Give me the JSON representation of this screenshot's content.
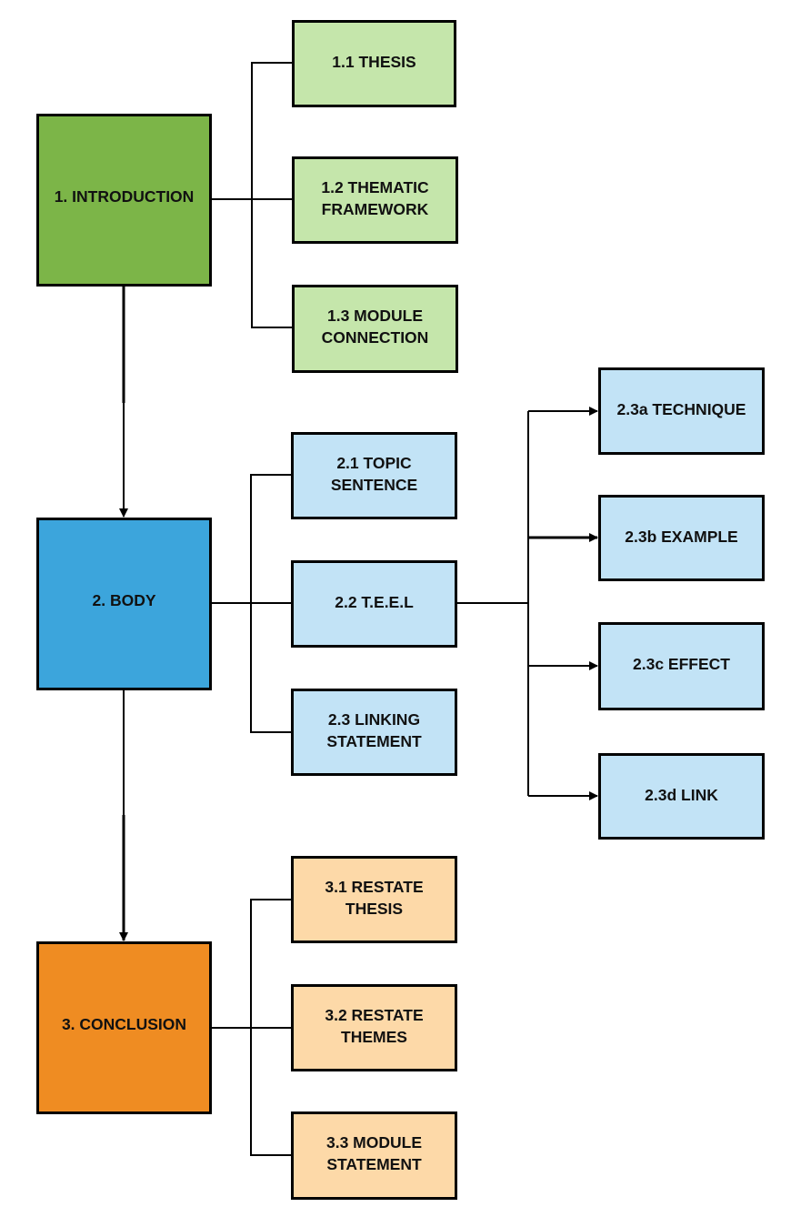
{
  "diagram": {
    "colors": {
      "intro": "#7cb548",
      "intro_light": "#c5e6ab",
      "body": "#3ca5dc",
      "body_light": "#c2e3f6",
      "conclusion": "#ef8c22",
      "conclusion_light": "#fdd9a8",
      "line": "#000000"
    },
    "sections": [
      {
        "id": "intro",
        "label": "1. INTRODUCTION",
        "children": [
          {
            "id": "1.1",
            "label": "1.1 THESIS"
          },
          {
            "id": "1.2",
            "label": "1.2 THEMATIC\nFRAMEWORK"
          },
          {
            "id": "1.3",
            "label": "1.3 MODULE\nCONNECTION"
          }
        ]
      },
      {
        "id": "body",
        "label": "2. BODY",
        "children": [
          {
            "id": "2.1",
            "label": "2.1 TOPIC\nSENTENCE"
          },
          {
            "id": "2.2",
            "label": "2.2 T.E.E.L"
          },
          {
            "id": "2.3",
            "label": "2.3 LINKING\nSTATEMENT"
          }
        ],
        "teel": [
          {
            "id": "2.3a",
            "label": "2.3a TECHNIQUE"
          },
          {
            "id": "2.3b",
            "label": "2.3b EXAMPLE"
          },
          {
            "id": "2.3c",
            "label": "2.3c EFFECT"
          },
          {
            "id": "2.3d",
            "label": "2.3d LINK"
          }
        ]
      },
      {
        "id": "conclusion",
        "label": "3. CONCLUSION",
        "children": [
          {
            "id": "3.1",
            "label": "3.1 RESTATE\nTHESIS"
          },
          {
            "id": "3.2",
            "label": "3.2 RESTATE\nTHEMES"
          },
          {
            "id": "3.3",
            "label": "3.3 MODULE\nSTATEMENT"
          }
        ]
      }
    ]
  }
}
